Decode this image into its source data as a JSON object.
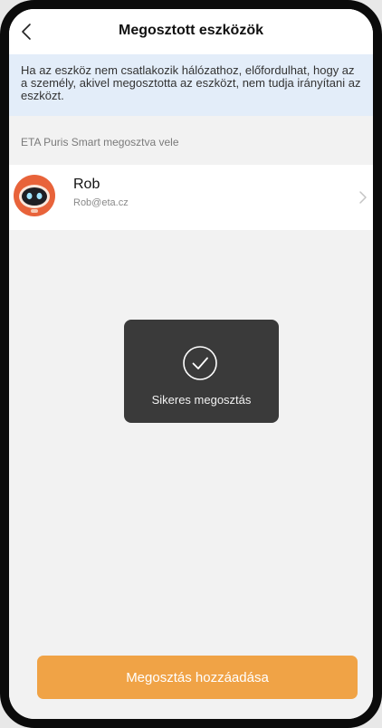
{
  "header": {
    "title": "Megosztott eszközök",
    "back_icon": "chevron-left-icon"
  },
  "notice": {
    "text": "Ha az eszköz nem csatlakozik hálózathoz, előfordulhat, hogy az a személy, akivel megosztotta az eszközt, nem tudja irányítani az eszközt."
  },
  "shared_with": {
    "label": "ETA Puris Smart  megosztva vele",
    "users": [
      {
        "name": "Rob",
        "email": "Rob@eta.cz",
        "avatar_icon": "robot-avatar-icon"
      }
    ]
  },
  "toast": {
    "icon": "check-circle-icon",
    "message": "Sikeres megosztás"
  },
  "footer": {
    "add_button_label": "Megosztás hozzáadása"
  },
  "colors": {
    "accent": "#f0a346",
    "notice_bg": "#e3edf9",
    "toast_bg": "#3a3a3a",
    "avatar_orange": "#e8633a"
  }
}
